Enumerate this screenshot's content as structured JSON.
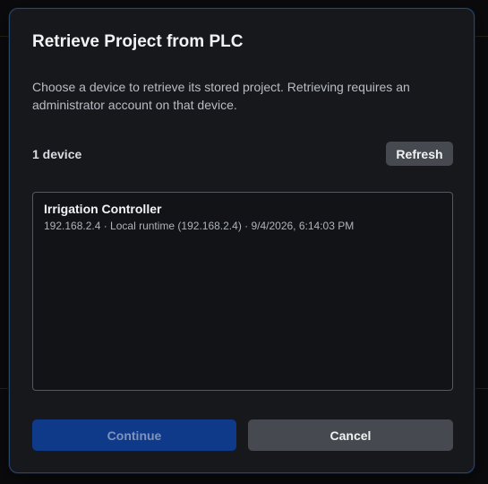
{
  "dialog": {
    "title": "Retrieve Project from PLC",
    "description": "Choose a device to retrieve its stored project. Retrieving requires an administrator account on that device."
  },
  "devices": {
    "count_label": "1 device",
    "refresh_label": "Refresh",
    "items": [
      {
        "name": "Irrigation Controller",
        "meta": "192.168.2.4 · Local runtime (192.168.2.4) · 9/4/2026, 6:14:03 PM"
      }
    ]
  },
  "actions": {
    "continue_label": "Continue",
    "continue_disabled": true,
    "cancel_label": "Cancel"
  },
  "colors": {
    "dialog_bg": "#17181b",
    "dialog_border": "#27466e",
    "primary_disabled": "#0f3a8a",
    "secondary_button": "#474950"
  }
}
